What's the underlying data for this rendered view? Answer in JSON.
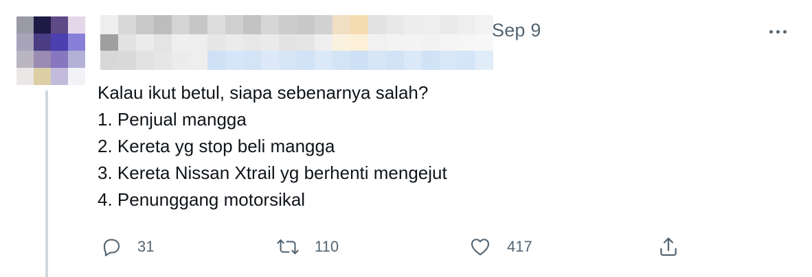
{
  "tweet": {
    "date": "Sep 9",
    "text_lines": [
      "Kalau ikut betul, siapa sebenarnya salah?",
      "1. Penjual mangga",
      "2. Kereta yg stop beli mangga",
      "3. Kereta Nissan Xtrail yg berhenti mengejut",
      "4. Penunggang motorsikal"
    ],
    "actions": {
      "reply_count": "31",
      "retweet_count": "110",
      "like_count": "417"
    }
  },
  "icons": {
    "reply": "reply-icon",
    "retweet": "retweet-icon",
    "like": "heart-icon",
    "share": "share-icon",
    "more": "more-icon"
  },
  "colors": {
    "text": "#0f1419",
    "secondary": "#536471",
    "thread_line": "#cfd9de"
  }
}
